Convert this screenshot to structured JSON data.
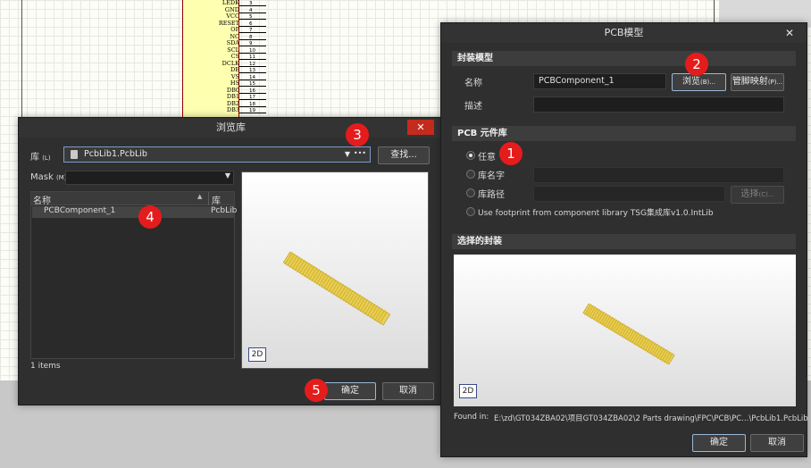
{
  "schematic": {
    "pins": [
      {
        "name": "LEDK",
        "num": "3"
      },
      {
        "name": "GND",
        "num": "4"
      },
      {
        "name": "VCC",
        "num": "5"
      },
      {
        "name": "RESET",
        "num": "6"
      },
      {
        "name": "OP",
        "num": "7"
      },
      {
        "name": "NC",
        "num": "8"
      },
      {
        "name": "SDA",
        "num": "9"
      },
      {
        "name": "SCL",
        "num": "10"
      },
      {
        "name": "CS",
        "num": "11"
      },
      {
        "name": "DCLK",
        "num": "12"
      },
      {
        "name": "DE",
        "num": "13"
      },
      {
        "name": "VS",
        "num": "14"
      },
      {
        "name": "HS",
        "num": "15"
      },
      {
        "name": "DB0",
        "num": "16"
      },
      {
        "name": "DB1",
        "num": "17"
      },
      {
        "name": "DB2",
        "num": "18"
      },
      {
        "name": "DB3",
        "num": "19"
      }
    ]
  },
  "browse_dialog": {
    "title": "浏览库",
    "close_glyph": "✕",
    "lib_label": "库",
    "lib_shortcut": "(L)",
    "lib_value": "PcbLib1.PcbLib",
    "more_glyph": "•••",
    "dropdown_glyph": "▼",
    "find_button": "查找...",
    "mask_label": "Mask",
    "mask_shortcut": "(M)",
    "columns": [
      "名称",
      "库"
    ],
    "sort_glyph": "▲",
    "rows": [
      {
        "name": "PCBComponent_1",
        "lib": "PcbLib"
      }
    ],
    "count_text": "1 items",
    "view_2d": "2D",
    "ok_button": "确定",
    "cancel_button": "取消"
  },
  "pcb_dialog": {
    "title": "PCB模型",
    "close_glyph": "✕",
    "footprint_section": "封装模型",
    "name_label": "名称",
    "name_value": "PCBComponent_1",
    "browse_button": "浏览",
    "browse_shortcut": "(B)...",
    "pin_map_button": "管脚映射",
    "pin_map_shortcut": "(P)...",
    "desc_label": "描述",
    "desc_value": "",
    "library_section": "PCB 元件库",
    "radio_any": "任意",
    "radio_lib_name": "库名字",
    "radio_lib_path": "库路径",
    "select_button": "选择",
    "select_shortcut": "(C)...",
    "use_footprint_text": "Use footprint from component library TSG集成库v1.0.IntLib",
    "selected_section": "选择的封装",
    "view_2d": "2D",
    "found_in_label": "Found in:",
    "found_in_path": "E:\\zd\\GT034ZBA02\\项目GT034ZBA02\\2 Parts drawing\\FPC\\PCB\\PC...\\PcbLib1.PcbLib",
    "ok_button": "确定",
    "cancel_button": "取消"
  },
  "annotations": [
    "1",
    "2",
    "3",
    "4",
    "5"
  ],
  "colors": {
    "dialog_bg": "#2f2f2f",
    "badge_red": "#e51c1c",
    "close_red": "#c42b1c",
    "footprint_gold": "#d9b82a",
    "component_fill": "#ffffb0"
  }
}
